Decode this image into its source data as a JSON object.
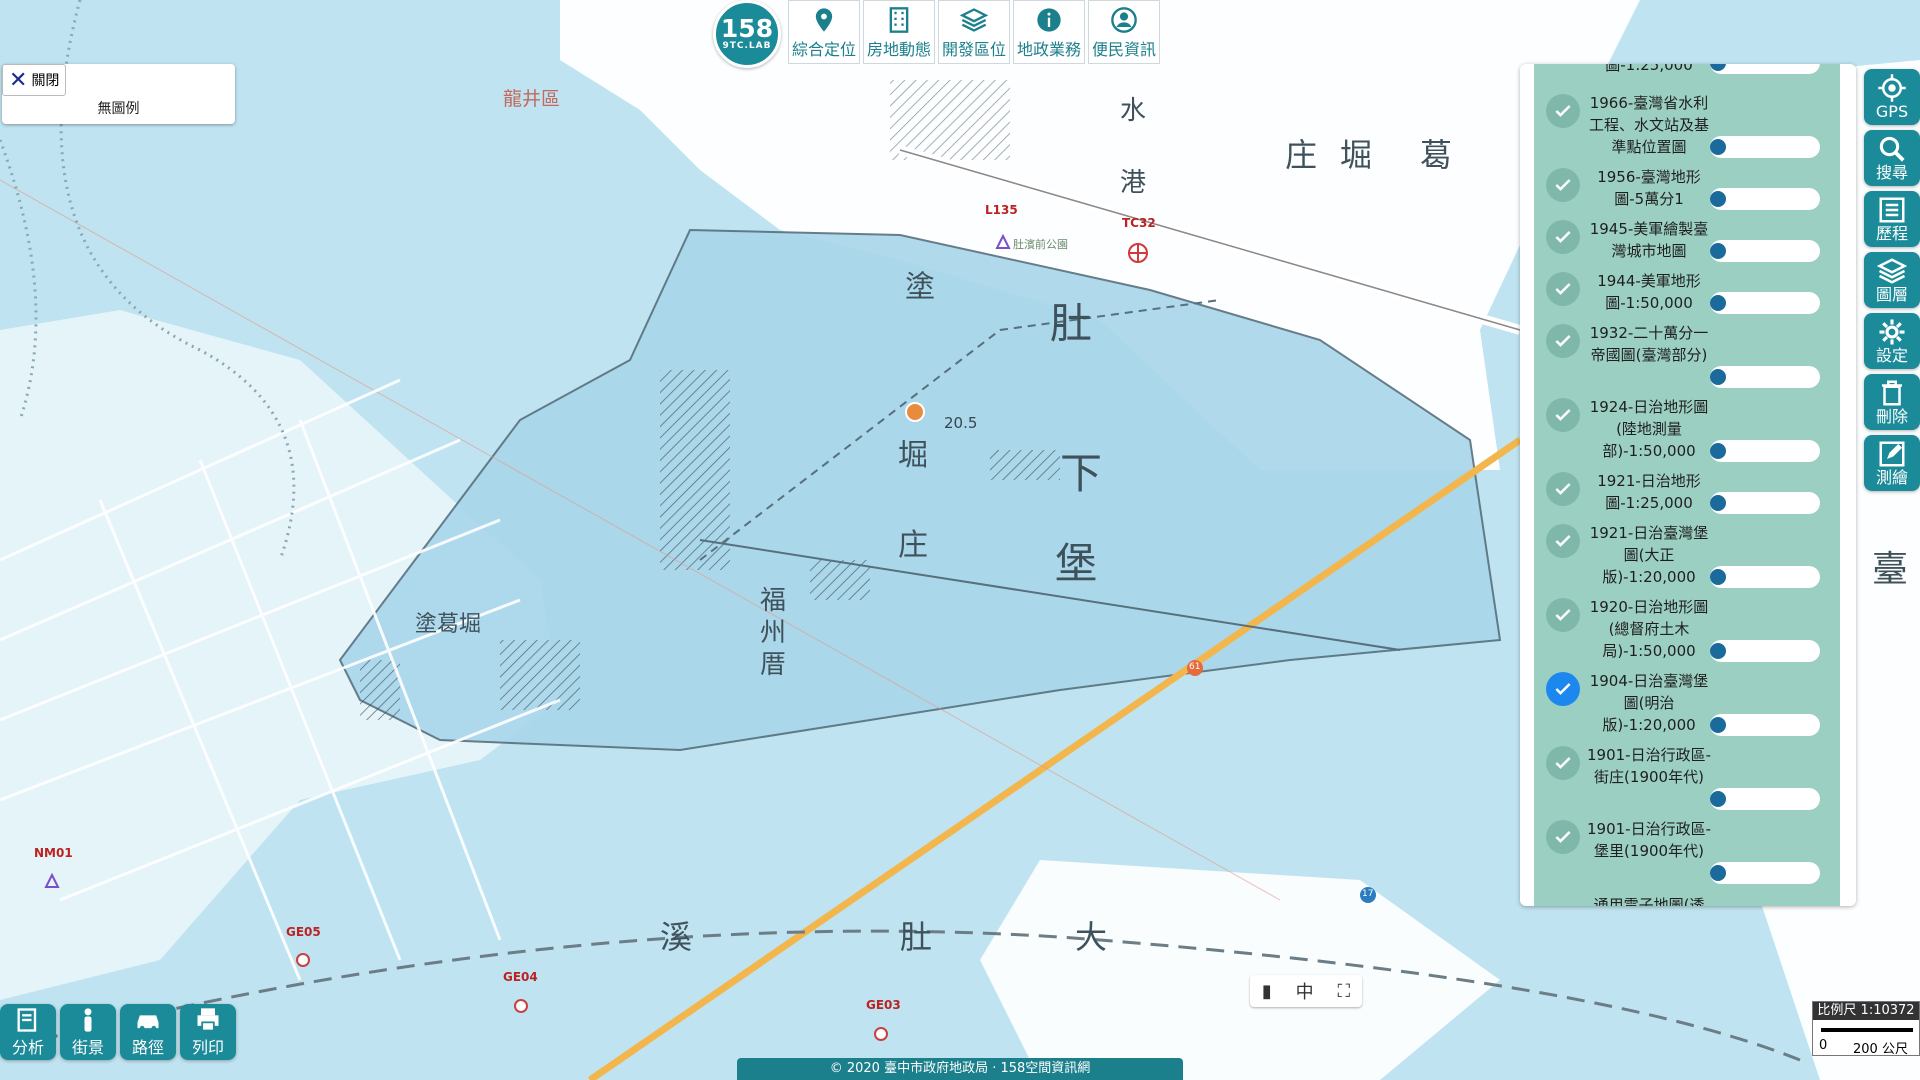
{
  "logo": {
    "number": "158",
    "sub": "9TC.LAB"
  },
  "topnav": [
    {
      "label": "綜合定位",
      "icon": "map-pin-icon"
    },
    {
      "label": "房地動態",
      "icon": "building-icon"
    },
    {
      "label": "開發區位",
      "icon": "layers-icon"
    },
    {
      "label": "地政業務",
      "icon": "info-icon"
    },
    {
      "label": "便民資訊",
      "icon": "user-icon"
    }
  ],
  "legend": {
    "close_label": "關閉",
    "text": "無圖例"
  },
  "layer_panel": {
    "top_partial": "圖-1:25,000",
    "items": [
      {
        "title": "1966-臺灣省水利工程、水文站及基準點位置圖",
        "checked": false
      },
      {
        "title": "1956-臺灣地形圖-5萬分1",
        "checked": false
      },
      {
        "title": "1945-美軍繪製臺灣城市地圖",
        "checked": false
      },
      {
        "title": "1944-美軍地形圖-1:50,000",
        "checked": false
      },
      {
        "title": "1932-二十萬分一帝國圖(臺灣部分)",
        "checked": false
      },
      {
        "title": "1924-日治地形圖(陸地測量部)-1:50,000",
        "checked": false
      },
      {
        "title": "1921-日治地形圖-1:25,000",
        "checked": false
      },
      {
        "title": "1921-日治臺灣堡圖(大正版)-1:20,000",
        "checked": false
      },
      {
        "title": "1920-日治地形圖(總督府土木局)-1:50,000",
        "checked": false
      },
      {
        "title": "1904-日治臺灣堡圖(明治版)-1:20,000",
        "checked": true
      },
      {
        "title": "1901-日治行政區-街庄(1900年代)",
        "checked": false
      },
      {
        "title": "1901-日治行政區-堡里(1900年代)",
        "checked": false
      }
    ],
    "bottom_partial": "通用電子地圖(透"
  },
  "right_tools": [
    {
      "label": "GPS",
      "icon": "gps-icon"
    },
    {
      "label": "搜尋",
      "icon": "search-icon"
    },
    {
      "label": "歷程",
      "icon": "history-icon"
    },
    {
      "label": "圖層",
      "icon": "layers-icon"
    },
    {
      "label": "設定",
      "icon": "gear-icon"
    },
    {
      "label": "刪除",
      "icon": "trash-icon"
    },
    {
      "label": "測繪",
      "icon": "pencil-icon"
    }
  ],
  "bottom_tools": [
    {
      "label": "分析",
      "icon": "analysis-icon"
    },
    {
      "label": "街景",
      "icon": "pegman-icon"
    },
    {
      "label": "路徑",
      "icon": "car-icon"
    },
    {
      "label": "列印",
      "icon": "printer-icon"
    }
  ],
  "copyright": "© 2020 臺中市政府地政局 · 158空間資訊網",
  "mini_tools": {
    "lang": "中"
  },
  "scale": {
    "label": "比例尺 1:10372",
    "zero": "0",
    "distance": "200 公尺"
  },
  "map_labels": {
    "district": "龍井區",
    "road1": "L135",
    "road2": "TC32",
    "park": "肚濱前公園",
    "point1": "NM01",
    "point2": "GE05",
    "point3": "GE04",
    "point4": "GE03",
    "elev": "20.5",
    "route": "61",
    "route2": "17",
    "place_a": "塗",
    "place_b": "肚",
    "place_c": "下",
    "place_d": "堡",
    "place_e": "庄",
    "place_f": "堀",
    "place_g": "福",
    "place_h": "州",
    "place_i": "厝",
    "place_j": "塗葛堀",
    "place_k": "溪",
    "place_l": "大",
    "place_m": "臺",
    "place_n": "水",
    "place_o": "港",
    "place_p": "堀",
    "place_q": "葛",
    "place_r": "庄",
    "place_s": "肚"
  },
  "colors": {
    "accent": "#1b8b99",
    "water": "#bfe3f0",
    "land": "#ffffff",
    "checked": "#1d87f0",
    "road": "#f3b64c"
  }
}
